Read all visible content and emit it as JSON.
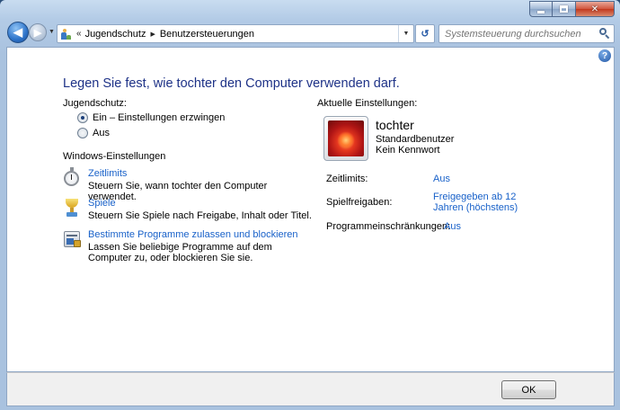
{
  "window": {
    "caption_buttons": {
      "minimize": "minimize-icon",
      "maximize": "maximize-icon",
      "close": "✕"
    }
  },
  "navigation": {
    "back_icon": "arrow-left-icon",
    "forward_icon": "arrow-right-icon",
    "overflow_marker": "«",
    "breadcrumb": [
      "Jugendschutz",
      "Benutzersteuerungen"
    ],
    "search_placeholder": "Systemsteuerung durchsuchen"
  },
  "main": {
    "heading": "Legen Sie fest, wie tochter den Computer verwenden darf.",
    "jugendschutz": {
      "label": "Jugendschutz:",
      "options": [
        {
          "label": "Ein – Einstellungen erzwingen",
          "checked": true
        },
        {
          "label": "Aus",
          "checked": false
        }
      ]
    },
    "windows_settings": {
      "label": "Windows-Einstellungen",
      "items": [
        {
          "icon": "stopwatch-icon",
          "title": "Zeitlimits",
          "description": "Steuern Sie, wann tochter den Computer verwendet."
        },
        {
          "icon": "trophy-icon",
          "title": "Spiele",
          "description": "Steuern Sie Spiele nach Freigabe, Inhalt oder Titel."
        },
        {
          "icon": "program-restriction-icon",
          "title": "Bestimmte Programme zulassen und blockieren",
          "description": "Lassen Sie beliebige Programme auf dem Computer zu, oder blockieren Sie sie."
        }
      ]
    },
    "current": {
      "label": "Aktuelle Einstellungen:",
      "user": {
        "name": "tochter",
        "type": "Standardbenutzer",
        "password": "Kein Kennwort"
      },
      "rows": [
        {
          "key": "Zeitlimits:",
          "value": "Aus"
        },
        {
          "key": "Spielfreigaben:",
          "value": "Freigegeben ab 12 Jahren (höchstens)"
        },
        {
          "key": "Programmeinschränkungen:",
          "value": "Aus"
        }
      ]
    }
  },
  "footer": {
    "ok_label": "OK"
  },
  "colors": {
    "link": "#1861c9",
    "heading": "#1e3287"
  }
}
